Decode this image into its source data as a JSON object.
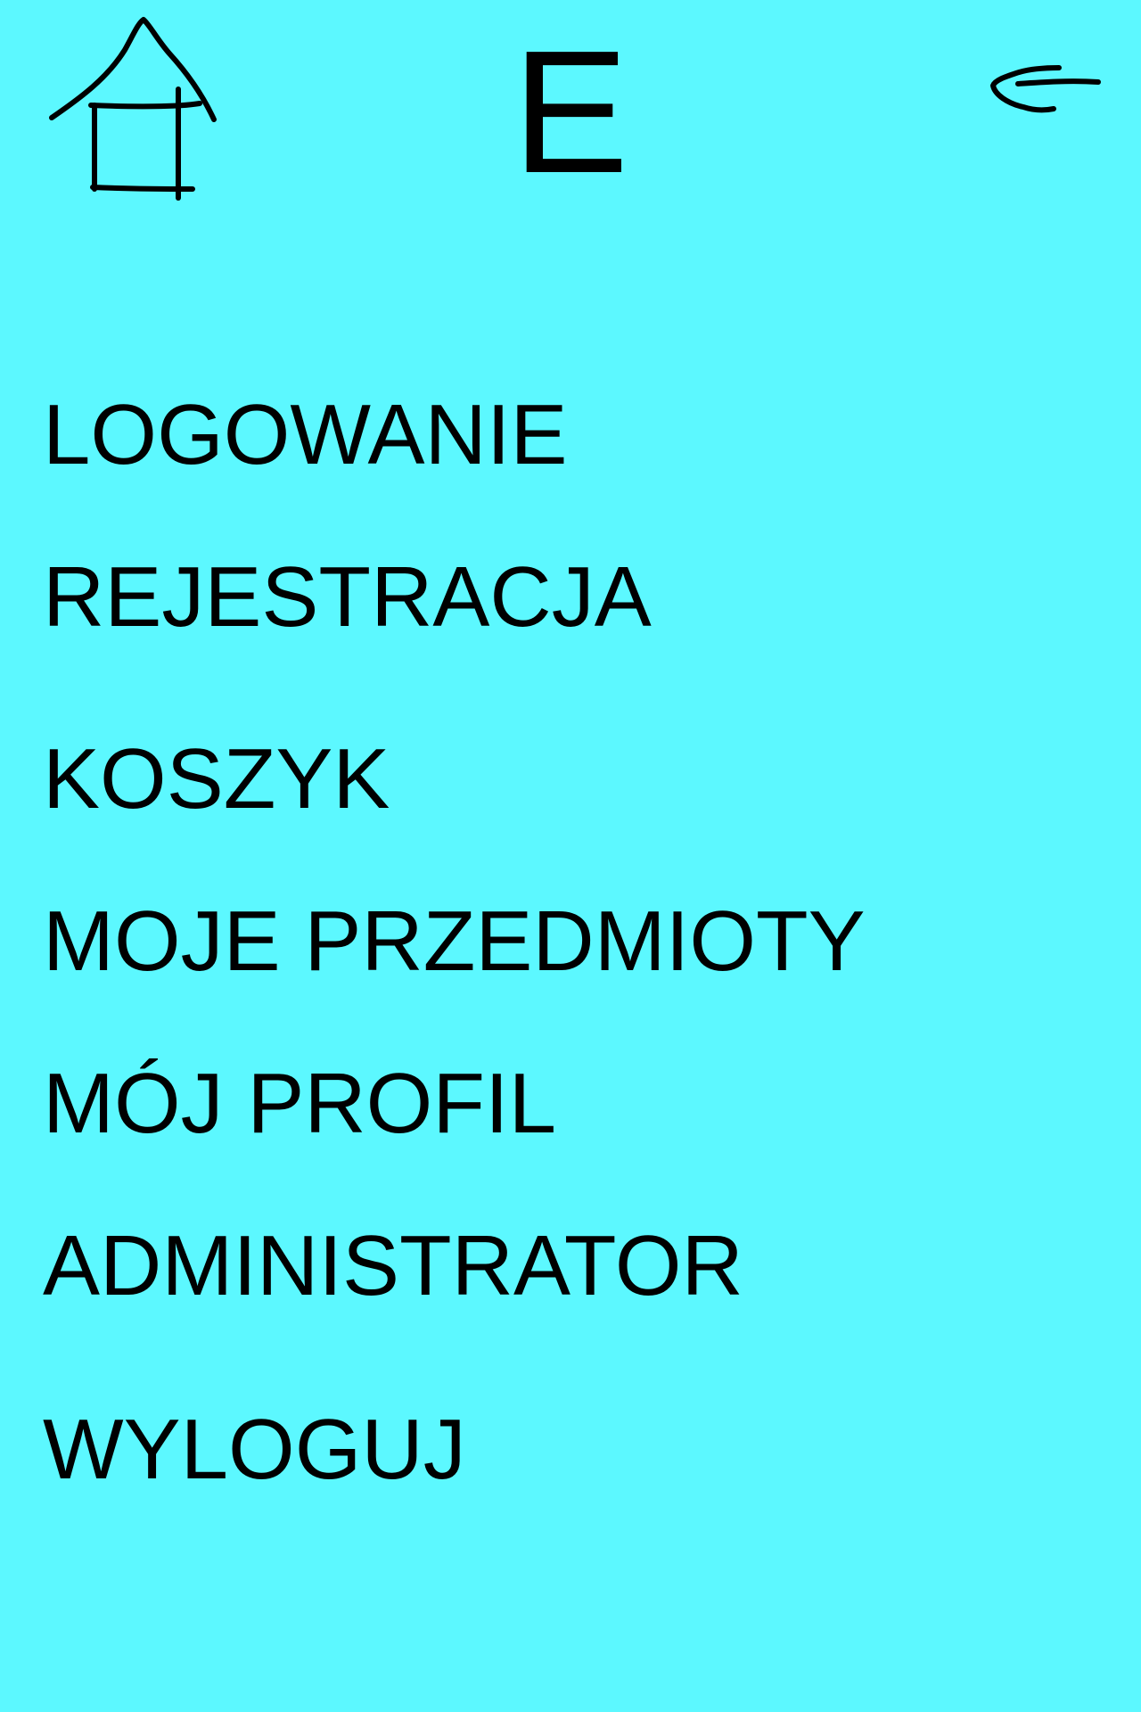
{
  "header": {
    "logo": "E",
    "home_icon": "house-icon",
    "back_icon": "arrow-left-icon"
  },
  "menu": {
    "items": [
      {
        "label": "LOGOWANIE"
      },
      {
        "label": "REJESTRACJA"
      },
      {
        "label": "KOSZYK"
      },
      {
        "label": "MOJE PRZEDMIOTY"
      },
      {
        "label": "MÓJ PROFIL"
      },
      {
        "label": "ADMINISTRATOR"
      },
      {
        "label": "WYLOGUJ"
      }
    ]
  },
  "colors": {
    "background": "#5cf8ff",
    "text": "#000000"
  }
}
